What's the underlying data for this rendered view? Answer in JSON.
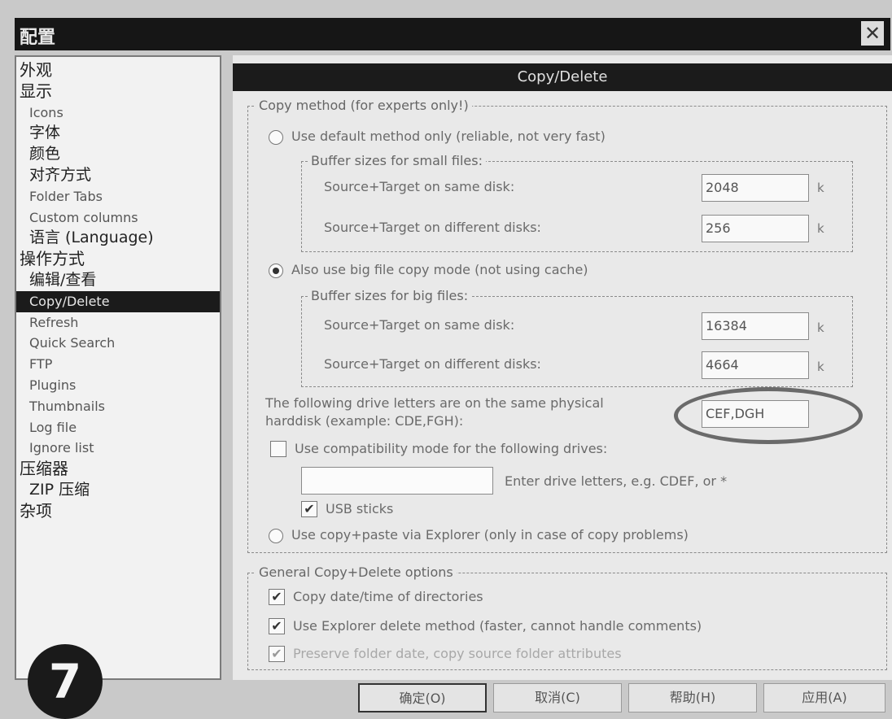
{
  "window": {
    "title": "配置",
    "close_glyph": "✕"
  },
  "tree": {
    "items": [
      {
        "label": "外观",
        "level": 0
      },
      {
        "label": "显示",
        "level": 0
      },
      {
        "label": "Icons",
        "level": 1
      },
      {
        "label": "字体",
        "level": 1
      },
      {
        "label": "颜色",
        "level": 1
      },
      {
        "label": "对齐方式",
        "level": 1
      },
      {
        "label": "Folder Tabs",
        "level": 1
      },
      {
        "label": "Custom columns",
        "level": 1
      },
      {
        "label": "语言 (Language)",
        "level": 1
      },
      {
        "label": "操作方式",
        "level": 0
      },
      {
        "label": "编辑/查看",
        "level": 1
      },
      {
        "label": "Copy/Delete",
        "level": 1,
        "selected": true
      },
      {
        "label": "Refresh",
        "level": 1
      },
      {
        "label": "Quick Search",
        "level": 1
      },
      {
        "label": "FTP",
        "level": 1
      },
      {
        "label": "Plugins",
        "level": 1
      },
      {
        "label": "Thumbnails",
        "level": 1
      },
      {
        "label": "Log file",
        "level": 1
      },
      {
        "label": "Ignore list",
        "level": 1
      },
      {
        "label": "压缩器",
        "level": 0
      },
      {
        "label": "ZIP 压缩",
        "level": 1
      },
      {
        "label": "杂项",
        "level": 0
      }
    ]
  },
  "panel": {
    "title": "Copy/Delete",
    "copy_method": {
      "group_label": "Copy method (for experts only!)",
      "option_default": "Use default method only (reliable, not very fast)",
      "small_files_label": "Buffer sizes for small files:",
      "small_same_label": "Source+Target on same disk:",
      "small_same_value": "2048",
      "small_diff_label": "Source+Target on different disks:",
      "small_diff_value": "256",
      "option_big": "Also use big file copy mode (not using cache)",
      "big_files_label": "Buffer sizes for big files:",
      "big_same_label": "Source+Target on same disk:",
      "big_same_value": "16384",
      "big_diff_label": "Source+Target on different disks:",
      "big_diff_value": "4664",
      "unit": "k",
      "physical_label_1": "The following drive letters are on the same physical",
      "physical_label_2": "harddisk (example: CDE,FGH):",
      "physical_value": "CEF,DGH",
      "compat_label": "Use compatibility mode for the following drives:",
      "compat_value": "",
      "compat_hint": "Enter drive letters, e.g. CDEF, or *",
      "usb_label": "USB sticks",
      "option_explorer": "Use copy+paste via Explorer (only in case of copy problems)"
    },
    "general": {
      "group_label": "General Copy+Delete options",
      "opt1": "Copy date/time of directories",
      "opt2": "Use Explorer delete method (faster, cannot handle comments)",
      "opt3": "Preserve folder date, copy source folder attributes"
    }
  },
  "step_number": "7",
  "buttons": {
    "ok": "确定(O)",
    "cancel": "取消(C)",
    "help": "帮助(H)",
    "apply": "应用(A)"
  }
}
